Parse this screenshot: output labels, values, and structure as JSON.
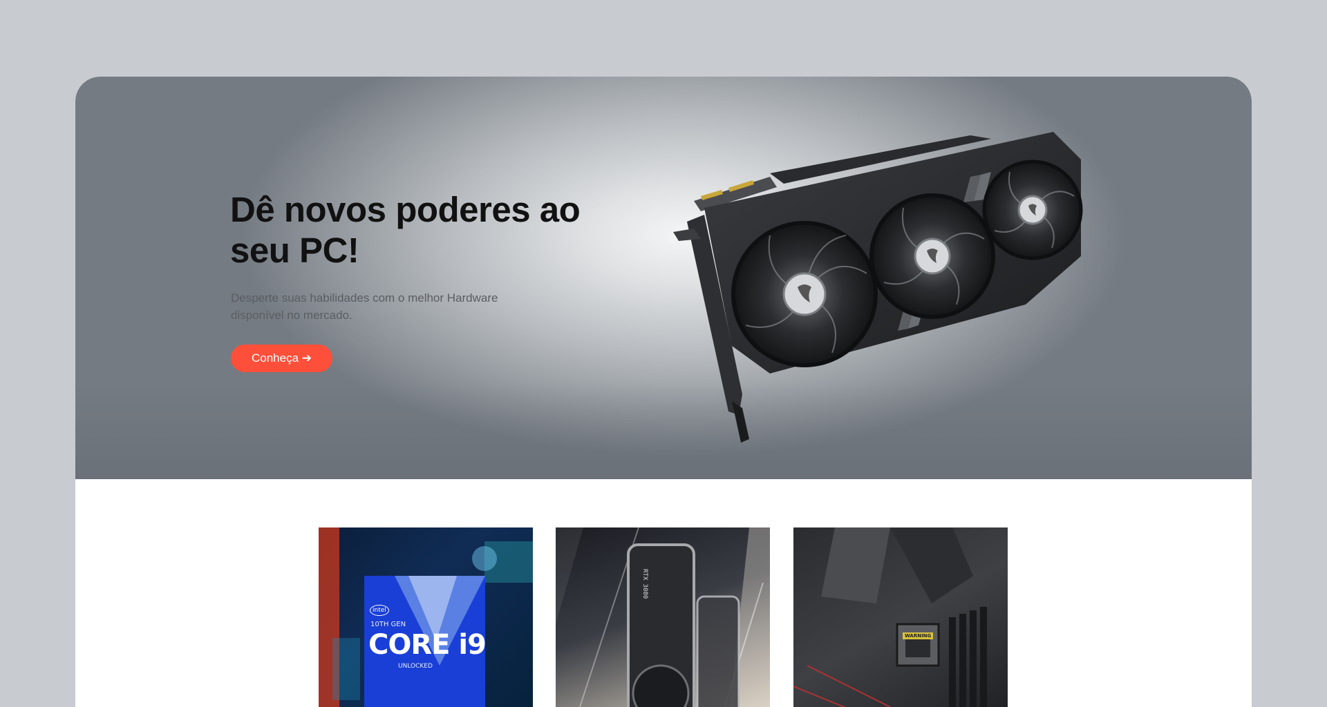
{
  "hero": {
    "title": "Dê novos poderes ao seu PC!",
    "subtitle": "Desperte suas habilidades com o melhor Hardware disponível no mercado.",
    "cta_label": "Conheça ➔"
  },
  "products": [
    {
      "icon": "intel-core-i9-box-icon",
      "intel_badge": "intel",
      "box_gen": "10TH GEN",
      "box_brand": "CORE i9",
      "box_unlocked": "UNLOCKED"
    },
    {
      "icon": "rtx-graphics-card-icon",
      "card_label": "RTX 3080"
    },
    {
      "icon": "motherboard-icon",
      "warning_label": "WARNING"
    }
  ],
  "colors": {
    "accent": "#fd4f3a",
    "page_background": "#c8cbcf",
    "title": "#111111"
  }
}
